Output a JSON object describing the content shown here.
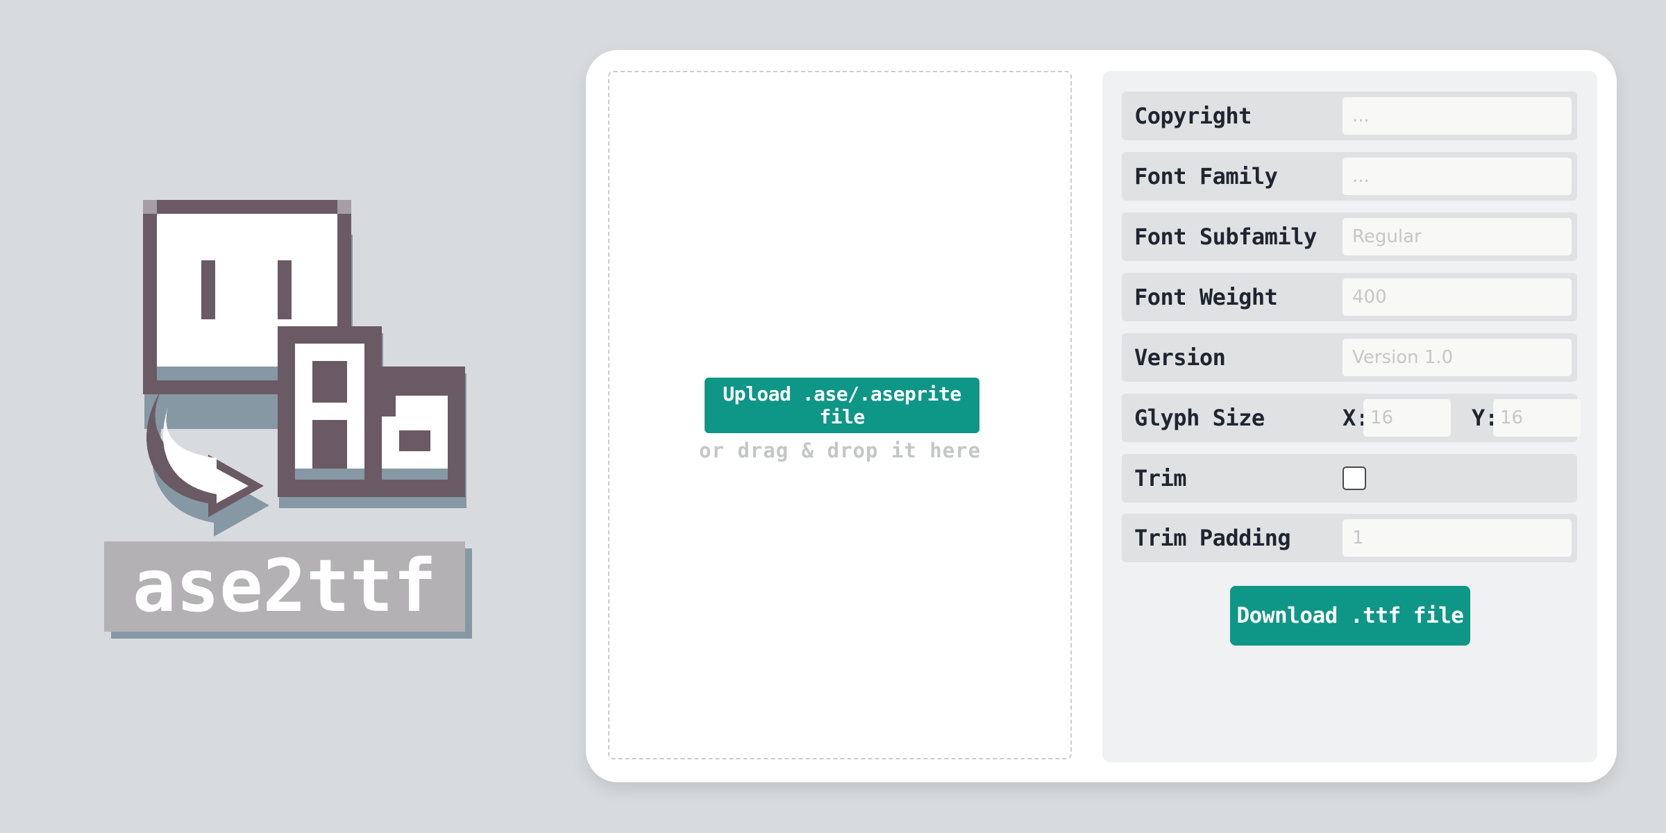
{
  "logo": {
    "wordmark": "ase2ttf",
    "glyph_text": "Aa"
  },
  "upload": {
    "button_label": "Upload .ase/.aseprite file",
    "drop_hint": "or drag & drop it here"
  },
  "settings": {
    "copyright": {
      "label": "Copyright",
      "placeholder": "...",
      "value": ""
    },
    "font_family": {
      "label": "Font Family",
      "placeholder": "...",
      "value": ""
    },
    "font_subfamily": {
      "label": "Font Subfamily",
      "placeholder": "Regular",
      "value": ""
    },
    "font_weight": {
      "label": "Font Weight",
      "placeholder": "400",
      "value": ""
    },
    "version": {
      "label": "Version",
      "placeholder": "Version 1.0",
      "value": ""
    },
    "glyph_size": {
      "label": "Glyph Size",
      "x_label": "X:",
      "x_placeholder": "16",
      "y_label": "Y:",
      "y_placeholder": "16"
    },
    "trim": {
      "label": "Trim",
      "checked": false
    },
    "trim_padding": {
      "label": "Trim Padding",
      "placeholder": "1",
      "value": ""
    }
  },
  "download": {
    "button_label": "Download .ttf file"
  },
  "colors": {
    "accent": "#0e9686",
    "background": "#d8dbde",
    "logo_dark": "#6a5a64",
    "logo_shadow": "#8698a4",
    "logo_wordmark_bg": "#b4b1b4"
  }
}
